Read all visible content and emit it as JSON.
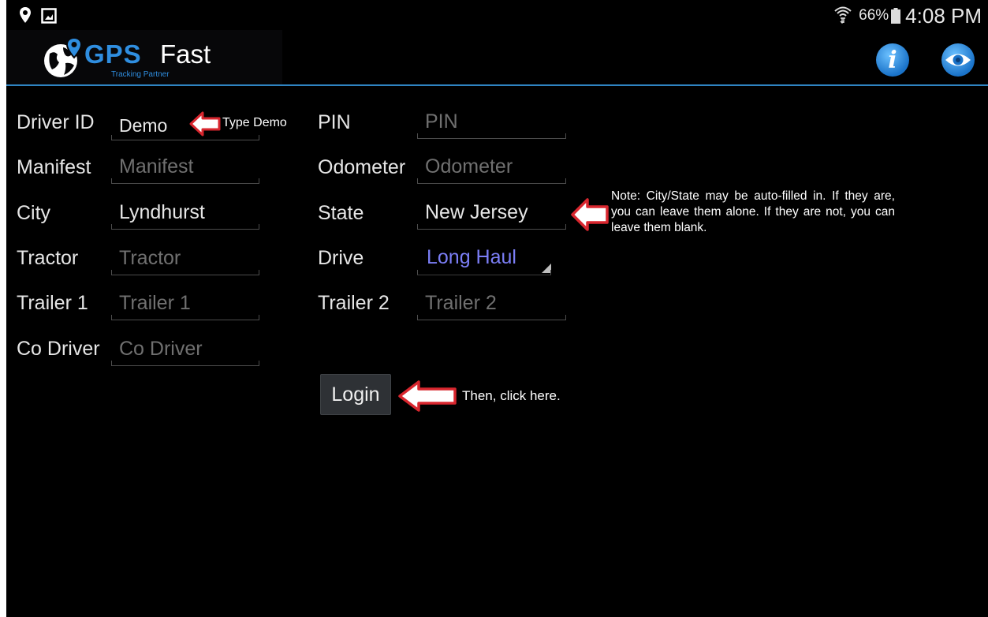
{
  "status_bar": {
    "icons": [
      "location-pin-icon",
      "gallery-icon",
      "wifi-icon",
      "battery-icon"
    ],
    "battery_percent": "66%",
    "time": "4:08 PM"
  },
  "app_bar": {
    "logo": {
      "gps": "GPS",
      "fast": "Fast",
      "tagline": "Tracking Partner"
    },
    "actions": [
      "info-icon",
      "eye-icon"
    ],
    "accent_color": "#2f84c2"
  },
  "form": {
    "driver_id": {
      "label": "Driver ID",
      "value": "Demo",
      "placeholder": ""
    },
    "pin": {
      "label": "PIN",
      "value": "",
      "placeholder": "PIN"
    },
    "manifest": {
      "label": "Manifest",
      "value": "",
      "placeholder": "Manifest"
    },
    "odometer": {
      "label": "Odometer",
      "value": "",
      "placeholder": "Odometer"
    },
    "city": {
      "label": "City",
      "value": "Lyndhurst",
      "placeholder": ""
    },
    "state": {
      "label": "State",
      "value": "New Jersey",
      "placeholder": ""
    },
    "tractor": {
      "label": "Tractor",
      "value": "",
      "placeholder": "Tractor"
    },
    "drive": {
      "label": "Drive",
      "selected": "Long Haul"
    },
    "trailer1": {
      "label": "Trailer 1",
      "value": "",
      "placeholder": "Trailer 1"
    },
    "trailer2": {
      "label": "Trailer 2",
      "value": "",
      "placeholder": "Trailer 2"
    },
    "co_driver": {
      "label": "Co Driver",
      "value": "",
      "placeholder": "Co Driver"
    },
    "login_label": "Login"
  },
  "annotations": {
    "type_demo": "Type Demo",
    "note": "Note: City/State may be auto-filled in. If they are, you can leave them alone. If they are not, you can leave them blank.",
    "click_here": "Then, click here.",
    "arrow_color": "#d8262e"
  }
}
